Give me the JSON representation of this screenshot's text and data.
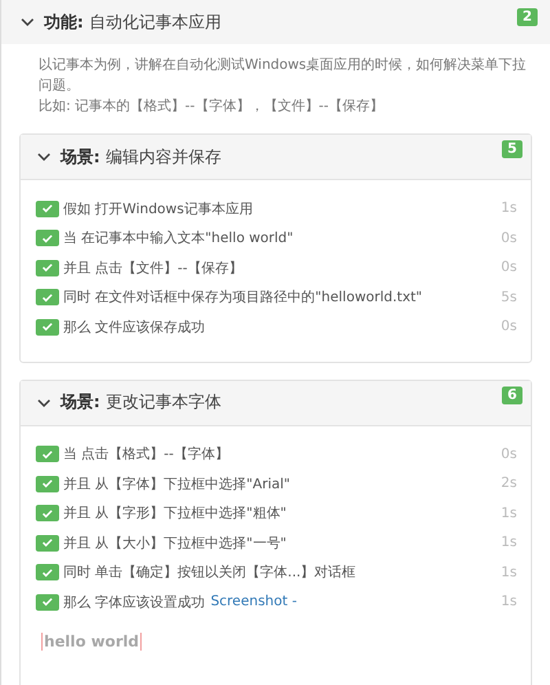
{
  "feature": {
    "keyword": "功能:",
    "name": "自动化记事本应用",
    "count": "2",
    "expanded": true,
    "description": [
      "以记事本为例，讲解在自动化测试Windows桌面应用的时候，如何解决菜单下拉问题。",
      "比如: 记事本的【格式】--【字体】，【文件】--【保存】"
    ]
  },
  "scenarios": [
    {
      "keyword": "场景:",
      "name": "编辑内容并保存",
      "count": "5",
      "expanded": true,
      "steps": [
        {
          "text": "假如 打开Windows记事本应用",
          "duration": "1s",
          "passed": true
        },
        {
          "text": "当 在记事本中输入文本\"hello world\"",
          "duration": "0s",
          "passed": true
        },
        {
          "text": "并且 点击【文件】--【保存】",
          "duration": "0s",
          "passed": true
        },
        {
          "text": "同时 在文件对话框中保存为项目路径中的\"helloworld.txt\"",
          "duration": "5s",
          "passed": true
        },
        {
          "text": "那么 文件应该保存成功",
          "duration": "0s",
          "passed": true
        }
      ]
    },
    {
      "keyword": "场景:",
      "name": "更改记事本字体",
      "count": "6",
      "expanded": true,
      "steps": [
        {
          "text": "当 点击【格式】--【字体】",
          "duration": "0s",
          "passed": true
        },
        {
          "text": "并且 从【字体】下拉框中选择\"Arial\"",
          "duration": "2s",
          "passed": true
        },
        {
          "text": "并且 从【字形】下拉框中选择\"粗体\"",
          "duration": "1s",
          "passed": true
        },
        {
          "text": "并且 从【大小】下拉框中选择\"一号\"",
          "duration": "1s",
          "passed": true
        },
        {
          "text": "同时 单击【确定】按钮以关闭【字体...】对话框",
          "duration": "1s",
          "passed": true
        },
        {
          "text": "那么 字体应该设置成功",
          "link": "Screenshot -",
          "duration": "1s",
          "passed": true,
          "screenshot": {
            "text": "hello world"
          }
        }
      ]
    }
  ]
}
